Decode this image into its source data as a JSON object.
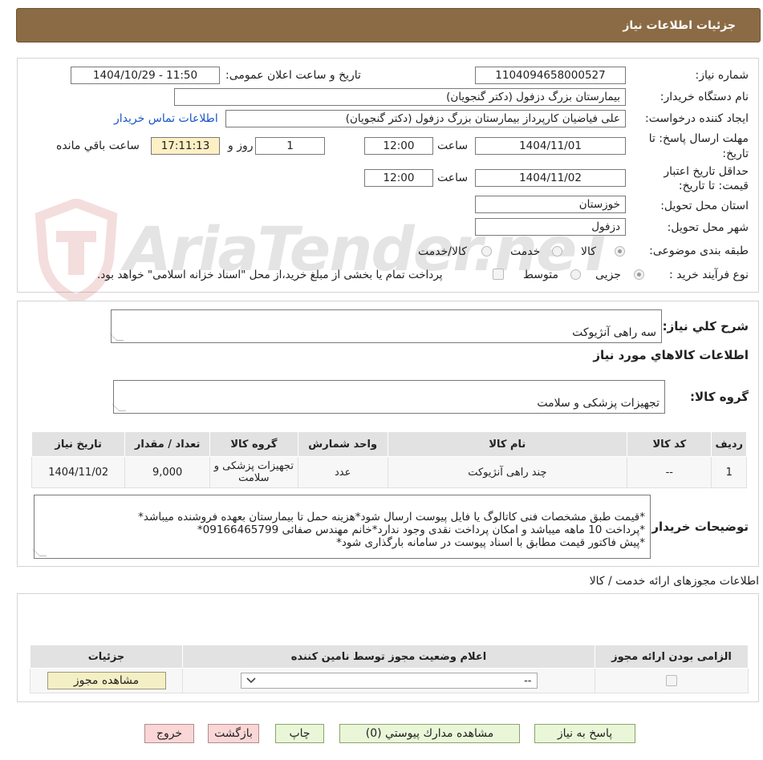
{
  "header": {
    "title": "جزئیات اطلاعات نیاز"
  },
  "info": {
    "need_number_label": "شماره نیاز:",
    "need_number": "1104094658000527",
    "announce_label": "تاریخ و ساعت اعلان عمومی:",
    "announce_value": "1404/10/29 - 11:50",
    "buyer_org_label": "نام دستگاه خریدار:",
    "buyer_org": "بیمارستان بزرگ دزفول (دکتر گنجویان)",
    "creator_label": "ایجاد کننده درخواست:",
    "creator": "علی فیاضیان کارپرداز بیمارستان بزرگ دزفول (دکتر گنجویان)",
    "contact_link": "اطلاعات تماس خریدار",
    "deadline_label_line1": "مهلت ارسال پاسخ: تا",
    "deadline_label_line2": "تاریخ:",
    "deadline_date": "1404/11/01",
    "time_label": "ساعت",
    "deadline_time": "12:00",
    "days_value": "1",
    "days_label": "روز و",
    "remaining_time": "17:11:13",
    "remaining_label": "ساعت باقي مانده",
    "validity_label_line1": "حداقل تاریخ اعتبار",
    "validity_label_line2": "قیمت: تا تاریخ:",
    "validity_date": "1404/11/02",
    "validity_time": "12:00",
    "province_label": "استان محل تحویل:",
    "province": "خوزستان",
    "city_label": "شهر محل تحویل:",
    "city": "دزفول",
    "category_label": "طبقه بندی موضوعی:",
    "category_options": [
      "کالا",
      "خدمت",
      "کالا/خدمت"
    ],
    "process_label": "نوع فرآیند خرید :",
    "process_options": [
      "جزیی",
      "متوسط"
    ],
    "payment_note": "پرداخت تمام یا بخشی از مبلغ خرید،از محل \"اسناد خزانه اسلامی\" خواهد بود."
  },
  "need": {
    "summary_label": "شرح کلي نياز:",
    "summary": "سه راهی آنژیوکت",
    "goods_title": "اطلاعات کالاهاي مورد نياز",
    "group_label": "گروه کالا:",
    "group": "تجهیزات پزشکی و سلامت",
    "columns": [
      "رديف",
      "کد کالا",
      "نام کالا",
      "واحد شمارش",
      "گروه کالا",
      "تعداد / مقدار",
      "تاريخ نياز"
    ],
    "rows": [
      [
        "1",
        "--",
        "چند راهی آنژیوکت",
        "عدد",
        "تجهیزات پزشکی و سلامت",
        "9,000",
        "1404/11/02"
      ]
    ],
    "buyer_notes_label": "توضیحات خریدار:",
    "buyer_notes": "*قیمت طبق مشخصات فنی کاتالوگ یا فایل پیوست ارسال شود*هزینه حمل تا بیمارستان بعهده فروشنده میباشد*\n*پرداخت 10 ماهه میباشد و امکان پرداخت نقدی وجود ندارد*خانم مهندس صفائی 09166465799*\n*پیش فاکتور قیمت مطابق با اسناد پیوست در سامانه بارگذاری شود*"
  },
  "permits": {
    "title": "اطلاعات مجوزهای ارائه خدمت / کالا",
    "columns": [
      "الزامی بودن ارائه مجوز",
      "اعلام وضعیت مجوز توسط نامین کننده",
      "جزئیات"
    ],
    "select_value": "--",
    "view_button": "مشاهده مجوز"
  },
  "buttons": {
    "respond": "پاسخ به نياز",
    "attachments": "مشاهده مدارك پيوستي (0)",
    "print": "چاپ",
    "back": "بازگشت",
    "exit": "خروج"
  },
  "watermark": {
    "text": "AriaTender.neT"
  }
}
